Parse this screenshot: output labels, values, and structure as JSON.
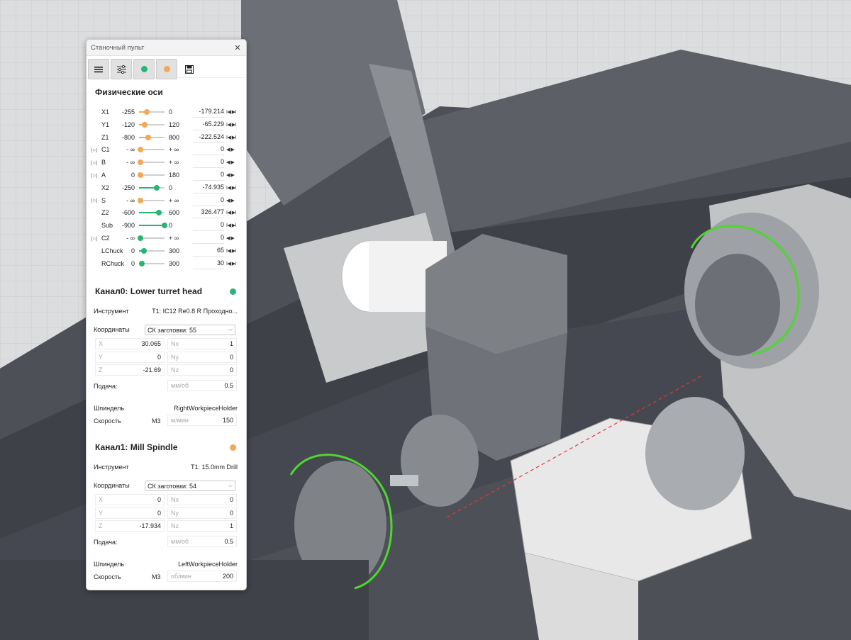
{
  "panel": {
    "title": "Станочный пульт",
    "toolbar": [
      {
        "icon": "menu-icon"
      },
      {
        "icon": "sliders-icon"
      },
      {
        "icon": "green-dot-icon",
        "color": "#27b574"
      },
      {
        "icon": "orange-dot-icon",
        "color": "#f3a857"
      },
      {
        "icon": "save-icon"
      }
    ],
    "colors": {
      "orange": "#f3a857",
      "green": "#27b574"
    },
    "axes_title": "Физические оси",
    "axes": [
      {
        "name": "X1",
        "lock": "",
        "min": "-255",
        "max": "0",
        "value": "-179.214",
        "level": 0.3,
        "color": "orange",
        "ctrl": "I◀ ▶I"
      },
      {
        "name": "Y1",
        "lock": "",
        "min": "-120",
        "max": "120",
        "value": "-65.229",
        "level": 0.23,
        "color": "orange",
        "ctrl": "I◀ ▶I"
      },
      {
        "name": "Z1",
        "lock": "",
        "min": "-800",
        "max": "800",
        "value": "-222.524",
        "level": 0.36,
        "color": "orange",
        "ctrl": "I◀ ▶I"
      },
      {
        "name": "C1",
        "lock": "(○)",
        "min": "- ∞",
        "max": "+ ∞",
        "value": "0",
        "level": 0.05,
        "color": "orange",
        "ctrl": "◀ ▶"
      },
      {
        "name": "B",
        "lock": "(○)",
        "min": "- ∞",
        "max": "+ ∞",
        "value": "0",
        "level": 0.05,
        "color": "orange",
        "ctrl": "◀ ▶"
      },
      {
        "name": "A",
        "lock": "(○)",
        "min": "0",
        "max": "180",
        "value": "0",
        "level": 0.05,
        "color": "orange",
        "ctrl": "◀ ▶"
      },
      {
        "name": "X2",
        "lock": "",
        "min": "-250",
        "max": "0",
        "value": "-74.935",
        "level": 0.7,
        "color": "green",
        "ctrl": "I◀ ▶I"
      },
      {
        "name": "S",
        "lock": "(○)",
        "min": "- ∞",
        "max": "+ ∞",
        "value": "0",
        "level": 0.05,
        "color": "orange",
        "ctrl": "◀ ▶"
      },
      {
        "name": "Z2",
        "lock": "",
        "min": "-600",
        "max": "600",
        "value": "326.477",
        "level": 0.77,
        "color": "green",
        "ctrl": "I◀ ▶I"
      },
      {
        "name": "Sub",
        "lock": "",
        "min": "-900",
        "max": "0",
        "value": "0",
        "level": 1.0,
        "color": "green",
        "ctrl": "I◀ ▶I"
      },
      {
        "name": "C2",
        "lock": "(○)",
        "min": "- ∞",
        "max": "+ ∞",
        "value": "0",
        "level": 0.05,
        "color": "green",
        "ctrl": "◀ ▶"
      },
      {
        "name": "LChuck",
        "lock": "",
        "min": "0",
        "max": "300",
        "value": "65",
        "level": 0.2,
        "color": "green",
        "ctrl": "I◀ ▶I"
      },
      {
        "name": "RChuck",
        "lock": "",
        "min": "0",
        "max": "300",
        "value": "30",
        "level": 0.1,
        "color": "green",
        "ctrl": "I◀ ▶I"
      }
    ],
    "channels": [
      {
        "title": "Канал0: Lower turret head",
        "status_color": "#27b574",
        "tool_label": "Инструмент",
        "tool": "T1: IC12 Re0.8 R Проходно...",
        "coords_label": "Координаты",
        "coords_value": "СК заготовки: 55",
        "fields": [
          {
            "k": "X",
            "v": "30.065"
          },
          {
            "k": "Nx",
            "v": "1"
          },
          {
            "k": "Y",
            "v": "0"
          },
          {
            "k": "Ny",
            "v": "0"
          },
          {
            "k": "Z",
            "v": "-21.69"
          },
          {
            "k": "Nz",
            "v": "0"
          }
        ],
        "feed_label": "Подача:",
        "feed_unit": "мм/об",
        "feed_value": "0.5",
        "spindle_label": "Шпиндель",
        "spindle_value": "RightWorkpieceHolder",
        "speed_label": "Скорость",
        "speed_mode": "M3",
        "speed_unit": "м/мин",
        "speed_value": "150"
      },
      {
        "title": "Канал1: Mill Spindle",
        "status_color": "#f3a857",
        "tool_label": "Инструмент",
        "tool": "T1: 15.0mm Drill",
        "coords_label": "Координаты",
        "coords_value": "СК заготовки: 54",
        "fields": [
          {
            "k": "X",
            "v": "0"
          },
          {
            "k": "Nx",
            "v": "0"
          },
          {
            "k": "Y",
            "v": "0"
          },
          {
            "k": "Ny",
            "v": "0"
          },
          {
            "k": "Z",
            "v": "-17.934"
          },
          {
            "k": "Nz",
            "v": "1"
          }
        ],
        "feed_label": "Подача:",
        "feed_unit": "мм/об",
        "feed_value": "0.5",
        "spindle_label": "Шпиндель",
        "spindle_value": "LeftWorkpieceHolder",
        "speed_label": "Скорость",
        "speed_mode": "M3",
        "speed_unit": "об/мин",
        "speed_value": "200"
      }
    ]
  }
}
